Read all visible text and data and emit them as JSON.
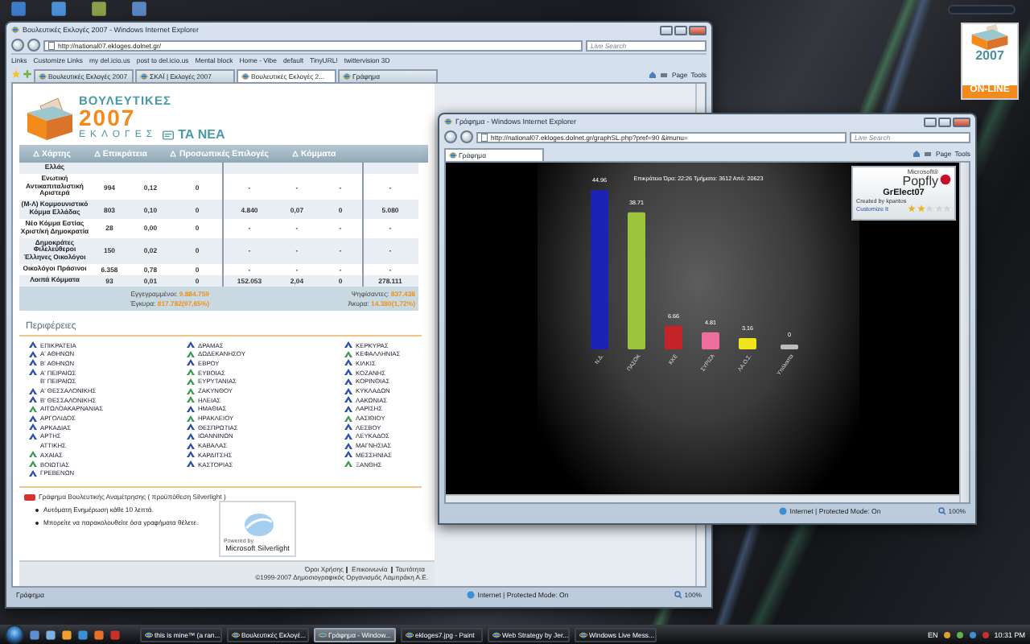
{
  "browser": {
    "title": "Βουλευτικές Εκλογές 2007 - Windows Internet Explorer",
    "address": "http://national07.ekloges.dolnet.gr/",
    "search": {
      "placeholder": "Live Search"
    },
    "links": [
      "Links",
      "Customize Links",
      "my del.icio.us",
      "post to del.icio.us",
      "Mental block",
      "Home - Vibe",
      "default",
      "TinyURL!",
      "twittervision 3D"
    ],
    "tabs": [
      {
        "label": "Βουλευτικές Εκλογές 2007",
        "selected": false
      },
      {
        "label": "ΣΚΑΪ | Εκλογές 2007",
        "selected": false
      },
      {
        "label": "Βουλευτικές Εκλογές 2...",
        "selected": true
      },
      {
        "label": "Γράφημα",
        "selected": false
      }
    ],
    "tools": [
      "Page",
      "Tools"
    ],
    "site": {
      "logo": {
        "title": "ΒΟΥΛΕΥΤΙΚΕΣ",
        "year": "2007",
        "subtitle": "ΕΚΛΟΓΕΣ",
        "brand": "ΤΑ ΝΕΑ"
      },
      "nav": [
        "Χάρτης",
        "Επικράτεια",
        "Προσωπικές Επιλογές",
        "Κόμματα"
      ],
      "table": {
        "rows": [
          {
            "name": "Ελλάς",
            "cells": []
          },
          {
            "name": "Ενωτική Αντικαπιταλιστική Αριστερά",
            "cells": [
              "994",
              "0,12",
              "0",
              "-",
              "-",
              "-",
              "-"
            ]
          },
          {
            "name": "(Μ-Λ) Κομμουνιστικό Κόμμα Ελλάδας",
            "cells": [
              "803",
              "0,10",
              "0",
              "4.840",
              "0,07",
              "0",
              "5.080"
            ]
          },
          {
            "name": "Νέο Κόμμα Εστίας Χριστ/κή Δημοκρατία",
            "cells": [
              "28",
              "0,00",
              "0",
              "-",
              "-",
              "-",
              "-"
            ]
          },
          {
            "name": "Δημοκράτες Φιλελεύθεροι Έλληνες Οικολόγοι",
            "cells": [
              "150",
              "0,02",
              "0",
              "-",
              "-",
              "-",
              "-"
            ]
          },
          {
            "name": "Οικολόγοι Πράσινοι",
            "cells": [
              "6.358",
              "0,78",
              "0",
              "-",
              "-",
              "-",
              "-"
            ]
          },
          {
            "name": "Λοιπά Κόμματα",
            "cells": [
              "93",
              "0,01",
              "0",
              "152.053",
              "2,04",
              "0",
              "278.111"
            ]
          }
        ]
      },
      "totals": [
        {
          "label": "Εγγεγραμμένοι:",
          "value": "9.884.759"
        },
        {
          "label": "Ψηφίσαντες:",
          "value": "837.438"
        },
        {
          "label": "Έγκυρα:",
          "value": "817.782(97,65%)"
        },
        {
          "label": "Άκυρα:",
          "value": "14.380(1,72%)"
        }
      ],
      "regions_title": "Περιφέρειες",
      "regions": [
        [
          {
            "name": "ΕΠΙΚΡΑΤΕΙΑ",
            "color": "#2b4ea6"
          },
          {
            "name": "Α' ΑΘΗΝΩΝ",
            "color": "#2b4ea6"
          },
          {
            "name": "Β' ΑΘΗΝΩΝ",
            "color": "#2b4ea6"
          },
          {
            "name": "Α' ΠΕΙΡΑΙΩΣ",
            "color": "#2b4ea6"
          },
          {
            "name": "Β' ΠΕΙΡΑΙΩΣ"
          },
          {
            "name": "Α' ΘΕΣΣΑΛΟΝΙΚΗΣ",
            "color": "#2b4ea6"
          },
          {
            "name": "Β' ΘΕΣΣΑΛΟΝΙΚΗΣ",
            "color": "#2b4ea6"
          },
          {
            "name": "ΑΙΤΩΛΟΑΚΑΡΝΑΝΙΑΣ",
            "color": "#3d9a52"
          },
          {
            "name": "ΑΡΓΟΛΙΔΟΣ",
            "color": "#2b4ea6"
          },
          {
            "name": "ΑΡΚΑΔΙΑΣ",
            "color": "#2b4ea6"
          },
          {
            "name": "ΑΡΤΗΣ",
            "color": "#2b4ea6"
          },
          {
            "name": "ΑΤΤΙΚΗΣ"
          },
          {
            "name": "ΑΧΑΙΑΣ",
            "color": "#3d9a52"
          },
          {
            "name": "ΒΟΙΩΤΙΑΣ",
            "color": "#3d9a52"
          },
          {
            "name": "ΓΡΕΒΕΝΩΝ",
            "color": "#2b4ea6"
          }
        ],
        [
          {
            "name": "ΔΡΑΜΑΣ",
            "color": "#2b4ea6"
          },
          {
            "name": "ΔΩΔΕΚΑΝΗΣΟΥ",
            "color": "#3d9a52"
          },
          {
            "name": "ΕΒΡΟΥ",
            "color": "#2b4ea6"
          },
          {
            "name": "ΕΥΒΟΙΑΣ",
            "color": "#3d9a52"
          },
          {
            "name": "ΕΥΡΥΤΑΝΙΑΣ",
            "color": "#3d9a52"
          },
          {
            "name": "ΖΑΚΥΝΘΟΥ",
            "color": "#3d9a52"
          },
          {
            "name": "ΗΛΕΙΑΣ",
            "color": "#3d9a52"
          },
          {
            "name": "ΗΜΑΘΙΑΣ",
            "color": "#2b4ea6"
          },
          {
            "name": "ΗΡΑΚΛΕΙΟΥ",
            "color": "#3d9a52"
          },
          {
            "name": "ΘΕΣΠΡΩΤΙΑΣ",
            "color": "#2b4ea6"
          },
          {
            "name": "ΙΩΑΝΝΙΝΩΝ",
            "color": "#2b4ea6"
          },
          {
            "name": "ΚΑΒΑΛΑΣ",
            "color": "#2b4ea6"
          },
          {
            "name": "ΚΑΡΔΙΤΣΗΣ",
            "color": "#2b4ea6"
          },
          {
            "name": "ΚΑΣΤΟΡΙΑΣ",
            "color": "#2b4ea6"
          }
        ],
        [
          {
            "name": "ΚΕΡΚΥΡΑΣ",
            "color": "#2b4ea6"
          },
          {
            "name": "ΚΕΦΑΛΛΗΝΙΑΣ",
            "color": "#3d9a52"
          },
          {
            "name": "ΚΙΛΚΙΣ",
            "color": "#2b4ea6"
          },
          {
            "name": "ΚΟΖΑΝΗΣ",
            "color": "#2b4ea6"
          },
          {
            "name": "ΚΟΡΙΝΘΙΑΣ",
            "color": "#2b4ea6"
          },
          {
            "name": "ΚΥΚΛΑΔΩΝ",
            "color": "#2b4ea6"
          },
          {
            "name": "ΛΑΚΩΝΙΑΣ",
            "color": "#2b4ea6"
          },
          {
            "name": "ΛΑΡΙΣΗΣ",
            "color": "#2b4ea6"
          },
          {
            "name": "ΛΑΣΙΘΙΟΥ",
            "color": "#3d9a52"
          },
          {
            "name": "ΛΕΣΒΟΥ",
            "color": "#2b4ea6"
          },
          {
            "name": "ΛΕΥΚΑΔΟΣ",
            "color": "#2b4ea6"
          },
          {
            "name": "ΜΑΓΝΗΣΙΑΣ",
            "color": "#2b4ea6"
          },
          {
            "name": "ΜΕΣΣΗΝΙΑΣ",
            "color": "#2b4ea6"
          },
          {
            "name": "ΞΑΝΘΗΣ",
            "color": "#3d9a52"
          }
        ]
      ],
      "silverlight": {
        "heading": "Γράφημα Βουλευτικής Αναμέτρησης ( προϋπόθεση Silverlight )",
        "bullets": [
          "Αυτόματη Ενημέρωση κάθε 10 λεπτά.",
          "Μπορείτε να παρακολουθείτε όσα γραφήματα θέλετε."
        ],
        "badge_top": "Powered by",
        "badge_name": "Microsoft Silverlight"
      },
      "footer": {
        "links": [
          "Όροι Χρήσης",
          "Επικοινωνία",
          "Ταυτότητα"
        ],
        "copyright": "©1999-2007 Δημοσιογραφικός Οργανισμός Λαμπράκη Α.Ε."
      }
    },
    "status": {
      "text": "Γράφημα",
      "zone": "Internet | Protected Mode: On",
      "zoom": "100%"
    }
  },
  "chart_window": {
    "title": "Γράφημα - Windows Internet Explorer",
    "address": "http://national07.ekloges.dolnet.gr/graphSL.php?pref=90 &imunu=",
    "search": {
      "placeholder": "Live Search"
    },
    "tab": "Γράφημα",
    "tools": [
      "Page",
      "Tools"
    ],
    "chart_data": {
      "type": "bar",
      "title": "Επικράτεια Ώρα: 22:26 Τμήματα: 3612 Από: 20623",
      "categories": [
        "Ν.Δ.",
        "ΠΑΣΟΚ",
        "ΚΚΕ",
        "ΣΥΡΙΖΑ",
        "ΛΑ.Ο.Σ.",
        "Υπόλοιπα"
      ],
      "values": [
        44.96,
        38.71,
        6.66,
        4.81,
        3.16,
        0
      ],
      "data_labels": true
    },
    "popfly": {
      "brand_top": "Microsoft®",
      "brand": "Popfly",
      "name": "GrElect07",
      "author": "Created by kpantos",
      "link": "Customize It",
      "stars": 2
    },
    "status": {
      "zone": "Internet | Protected Mode: On",
      "zoom": "100%"
    }
  },
  "gadget": {
    "year": "2007",
    "label": "ON-LINE"
  },
  "taskbar": {
    "tasks": [
      {
        "label": "this is mine™ (a ran...",
        "selected": false
      },
      {
        "label": "Βουλευτικές Εκλογέ...",
        "selected": false
      },
      {
        "label": "Γράφημα - Window...",
        "selected": true
      },
      {
        "label": "ekloges7.jpg - Paint",
        "selected": false
      },
      {
        "label": "Web Strategy by Jer...",
        "selected": false
      },
      {
        "label": "Windows Live Mess...",
        "selected": false
      }
    ],
    "language": "EN",
    "time": "10:31 PM"
  }
}
